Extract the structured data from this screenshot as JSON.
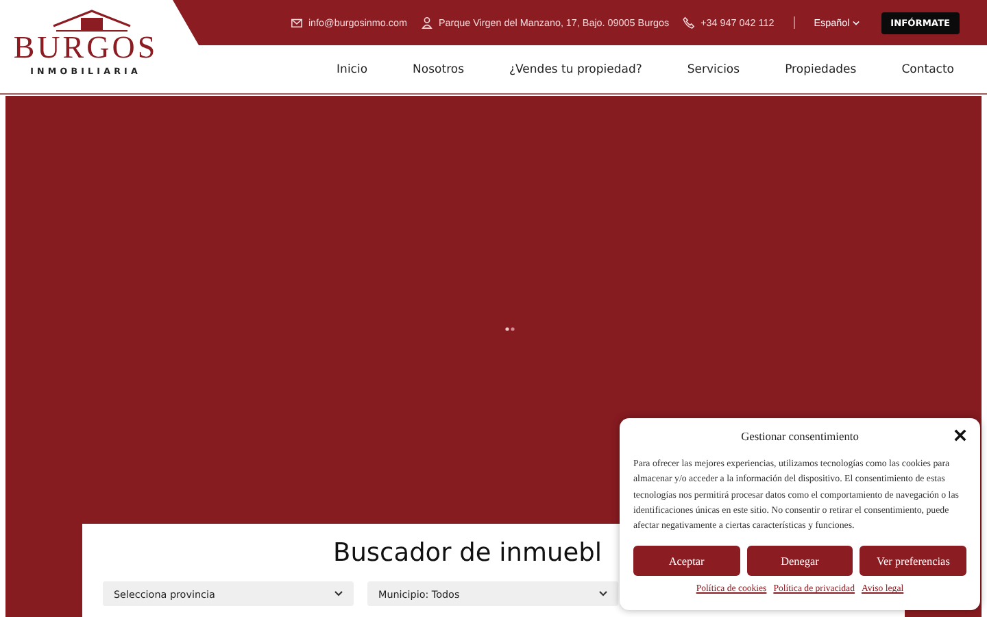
{
  "header": {
    "logo": {
      "name": "BURGOS",
      "tagline": "INMOBILIARIA"
    },
    "contact": [
      {
        "kind": "email",
        "text": "info@burgosinmo.com"
      },
      {
        "kind": "address",
        "text": "Parque Virgen del Manzano, 17, Bajo. 09005 Burgos"
      },
      {
        "kind": "phone",
        "text": "+34 947 042 112"
      }
    ],
    "language": "Español",
    "cta": "INFÓRMATE"
  },
  "nav": [
    "Inicio",
    "Nosotros",
    "¿Vendes tu propiedad?",
    "Servicios",
    "Propiedades",
    "Contacto"
  ],
  "search": {
    "title": "Buscador de inmuebl",
    "fields": [
      {
        "value": "Selecciona provincia"
      },
      {
        "value": "Municipio: Todos"
      }
    ]
  },
  "consent": {
    "title": "Gestionar consentimiento",
    "body": "Para ofrecer las mejores experiencias, utilizamos tecnologías como las cookies para almacenar y/o acceder a la información del dispositivo. El consentimiento de estas tecnologías nos permitirá procesar datos como el comportamiento de navegación o las identificaciones únicas en este sitio. No consentir o retirar el consentimiento, puede afectar negativamente a ciertas características y funciones.",
    "buttons": [
      "Aceptar",
      "Denegar",
      "Ver preferencias"
    ],
    "links": [
      "Política de cookies",
      "Política de privacidad",
      "Aviso legal"
    ]
  }
}
